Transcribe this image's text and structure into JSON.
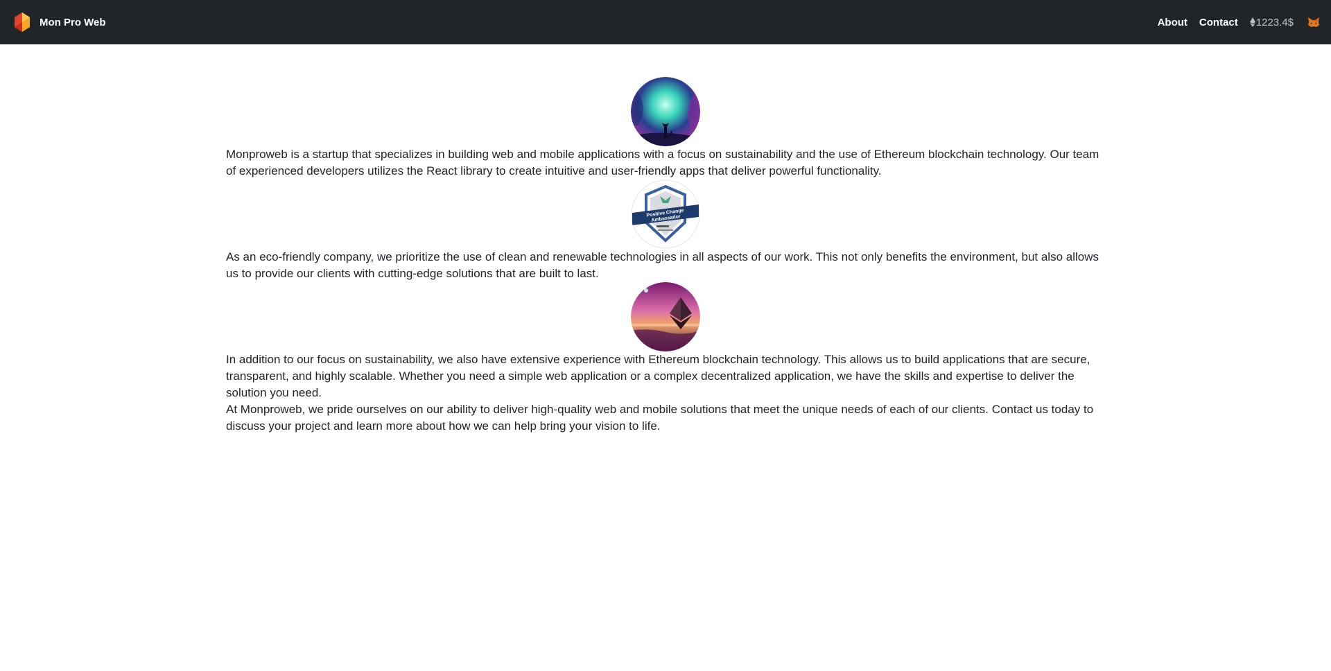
{
  "navbar": {
    "brand": "Mon Pro Web",
    "links": [
      "About",
      "Contact"
    ],
    "balance": "1223.4$",
    "colors": {
      "background": "#212529",
      "logo_orange": "#f5a623",
      "logo_red": "#e2452b"
    },
    "icons": [
      "brand-logo-icon",
      "ethereum-icon",
      "metamask-fox-icon"
    ]
  },
  "main": {
    "paragraphs": [
      "Monproweb is a startup that specializes in building web and mobile applications with a focus on sustainability and the use of Ethereum blockchain technology. Our team of experienced developers utilizes the React library to create intuitive and user-friendly apps that deliver powerful functionality.",
      "As an eco-friendly company, we prioritize the use of clean and renewable technologies in all aspects of our work. This not only benefits the environment, but also allows us to provide our clients with cutting-edge solutions that are built to last.",
      "In addition to our focus on sustainability, we also have extensive experience with Ethereum blockchain technology. This allows us to build applications that are secure, transparent, and highly scalable. Whether you need a simple web application or a complex decentralized application, we have the skills and expertise to deliver the solution you need.",
      "At Monproweb, we pride ourselves on our ability to deliver high-quality web and mobile solutions that meet the unique needs of each of our clients. Contact us today to discuss your project and learn more about how we can help bring your vision to life."
    ],
    "badge_text": [
      "Positive Change",
      "Ambassador"
    ]
  }
}
